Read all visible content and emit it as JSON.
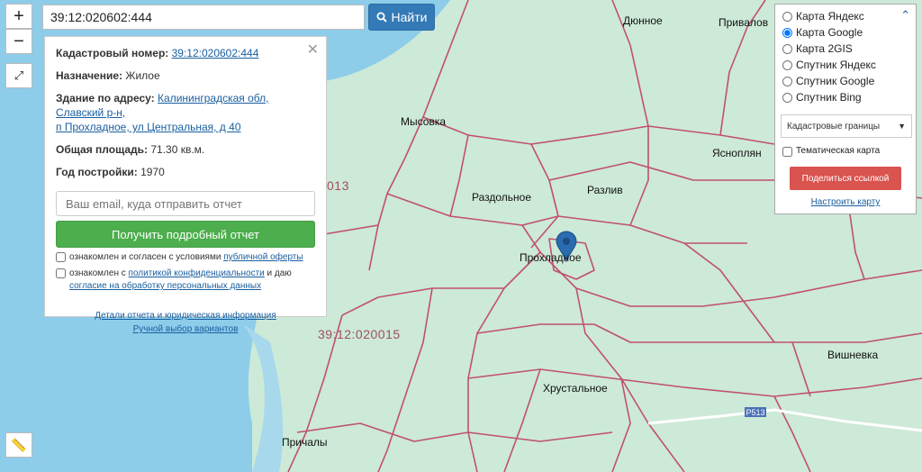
{
  "search": {
    "value": "39:12:020602:444",
    "button_label": "Найти"
  },
  "zoom": {
    "in": "+",
    "out": "−"
  },
  "info": {
    "cad_label": "Кадастровый номер:",
    "cad_value": "39:12:020602:444",
    "purpose_label": "Назначение:",
    "purpose_value": "Жилое",
    "address_label": "Здание по адресу:",
    "address_value_1": "Калининградская обл, Славский р-н,",
    "address_value_2": "п Прохладное, ул Центральная, д 40",
    "area_label": "Общая площадь:",
    "area_value": "71.30 кв.м.",
    "year_label": "Год постройки:",
    "year_value": "1970",
    "email_placeholder": "Ваш email, куда отправить отчет",
    "report_button": "Получить подробный отчет",
    "check1_text": "ознакомлен и согласен с условиями ",
    "check1_link": "публичной оферты",
    "check2_text": "ознакомлен с ",
    "check2_link": "политикой конфиденциальности",
    "check2_text2": " и даю",
    "check2_link2": "согласие на обработку персональных данных",
    "details_link": "Детали отчета и юридическая информация",
    "manual_link": "Ручной выбор вариантов"
  },
  "layers": {
    "options": [
      "Карта Яндекс",
      "Карта Google",
      "Карта 2GIS",
      "Спутник Яндекс",
      "Спутник Google",
      "Спутник Bing"
    ],
    "selected": "Карта Google",
    "select_value": "Кадастровые границы",
    "thematic_label": "Тематическая карта",
    "share_button": "Поделиться ссылкой",
    "setup_link": "Настроить карту"
  },
  "map": {
    "places": {
      "dyunnoe": "Дюнное",
      "privalovo": "Привалов",
      "mysovka": "Мысовка",
      "yasnopolyanka": "Ясноплян",
      "razdolnoe": "Раздольное",
      "razliv": "Разлив",
      "prokhladnoe": "Прохладное",
      "vishnevka": "Вишневка",
      "khrustalnoe": "Хрустальное",
      "prichaly": "Причалы"
    },
    "cadastral": {
      "q1": "39:12:020015",
      "q2": "013"
    },
    "road": "Р513"
  },
  "colors": {
    "land": "#cde9d8",
    "water": "#7fc8e6",
    "parcel": "#c05070",
    "accent": "#337ab7",
    "green_btn": "#4cae4c",
    "red_btn": "#d9534f"
  }
}
